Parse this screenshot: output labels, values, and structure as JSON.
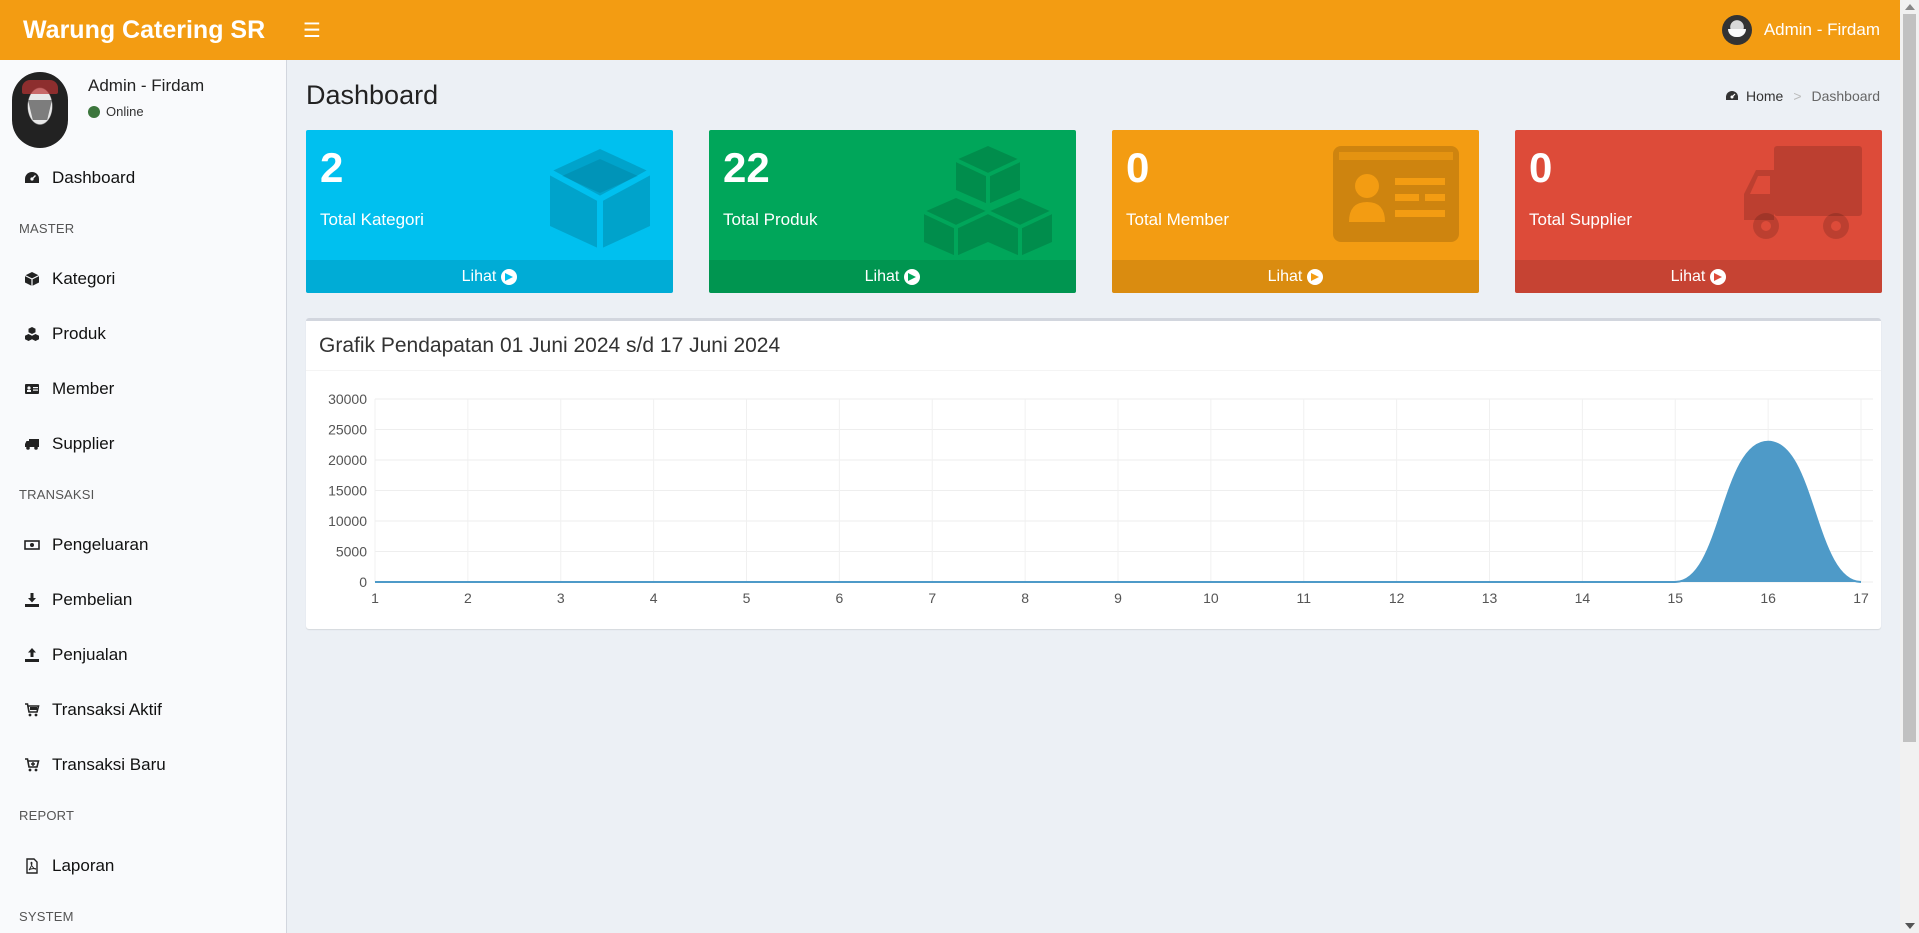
{
  "header": {
    "brand": "Warung Catering SR",
    "user_name": "Admin - Firdam",
    "color": "#f39c12"
  },
  "sidebar": {
    "user_name": "Admin - Firdam",
    "status": "Online",
    "items": [
      {
        "type": "item",
        "label": "Dashboard",
        "icon": "dashboard-icon"
      },
      {
        "type": "header",
        "label": "MASTER"
      },
      {
        "type": "item",
        "label": "Kategori",
        "icon": "cube-icon"
      },
      {
        "type": "item",
        "label": "Produk",
        "icon": "cubes-icon"
      },
      {
        "type": "item",
        "label": "Member",
        "icon": "id-card-icon"
      },
      {
        "type": "item",
        "label": "Supplier",
        "icon": "truck-icon"
      },
      {
        "type": "header",
        "label": "TRANSAKSI"
      },
      {
        "type": "item",
        "label": "Pengeluaran",
        "icon": "money-icon"
      },
      {
        "type": "item",
        "label": "Pembelian",
        "icon": "download-icon"
      },
      {
        "type": "item",
        "label": "Penjualan",
        "icon": "upload-icon"
      },
      {
        "type": "item",
        "label": "Transaksi Aktif",
        "icon": "cart-icon"
      },
      {
        "type": "item",
        "label": "Transaksi Baru",
        "icon": "cart-plus-icon"
      },
      {
        "type": "header",
        "label": "REPORT"
      },
      {
        "type": "item",
        "label": "Laporan",
        "icon": "pdf-icon"
      },
      {
        "type": "header",
        "label": "SYSTEM"
      }
    ]
  },
  "page": {
    "title": "Dashboard",
    "breadcrumb_home": "Home",
    "breadcrumb_active": "Dashboard"
  },
  "boxes": [
    {
      "value": "2",
      "label": "Total Kategori",
      "link": "Lihat",
      "color": "#00c0ef",
      "icon": "cube-icon"
    },
    {
      "value": "22",
      "label": "Total Produk",
      "link": "Lihat",
      "color": "#00a65a",
      "icon": "cubes-icon"
    },
    {
      "value": "0",
      "label": "Total Member",
      "link": "Lihat",
      "color": "#f39c12",
      "icon": "id-card-icon"
    },
    {
      "value": "0",
      "label": "Total Supplier",
      "link": "Lihat",
      "color": "#dd4b39",
      "icon": "truck-icon"
    }
  ],
  "chart_panel": {
    "title": "Grafik Pendapatan 01 Juni 2024 s/d 17 Juni 2024"
  },
  "chart_data": {
    "type": "area",
    "title": "Grafik Pendapatan 01 Juni 2024 s/d 17 Juni 2024",
    "x": [
      1,
      2,
      3,
      4,
      5,
      6,
      7,
      8,
      9,
      10,
      11,
      12,
      13,
      14,
      15,
      16,
      17
    ],
    "series": [
      {
        "values": [
          0,
          0,
          0,
          0,
          0,
          0,
          0,
          0,
          0,
          0,
          0,
          0,
          0,
          0,
          0,
          23000,
          0
        ],
        "color": "#4e9ac8"
      }
    ],
    "ylim": [
      0,
      30000
    ],
    "yticks": [
      0,
      5000,
      10000,
      15000,
      20000,
      25000,
      30000
    ],
    "grid": true,
    "xlabel": "",
    "ylabel": ""
  }
}
